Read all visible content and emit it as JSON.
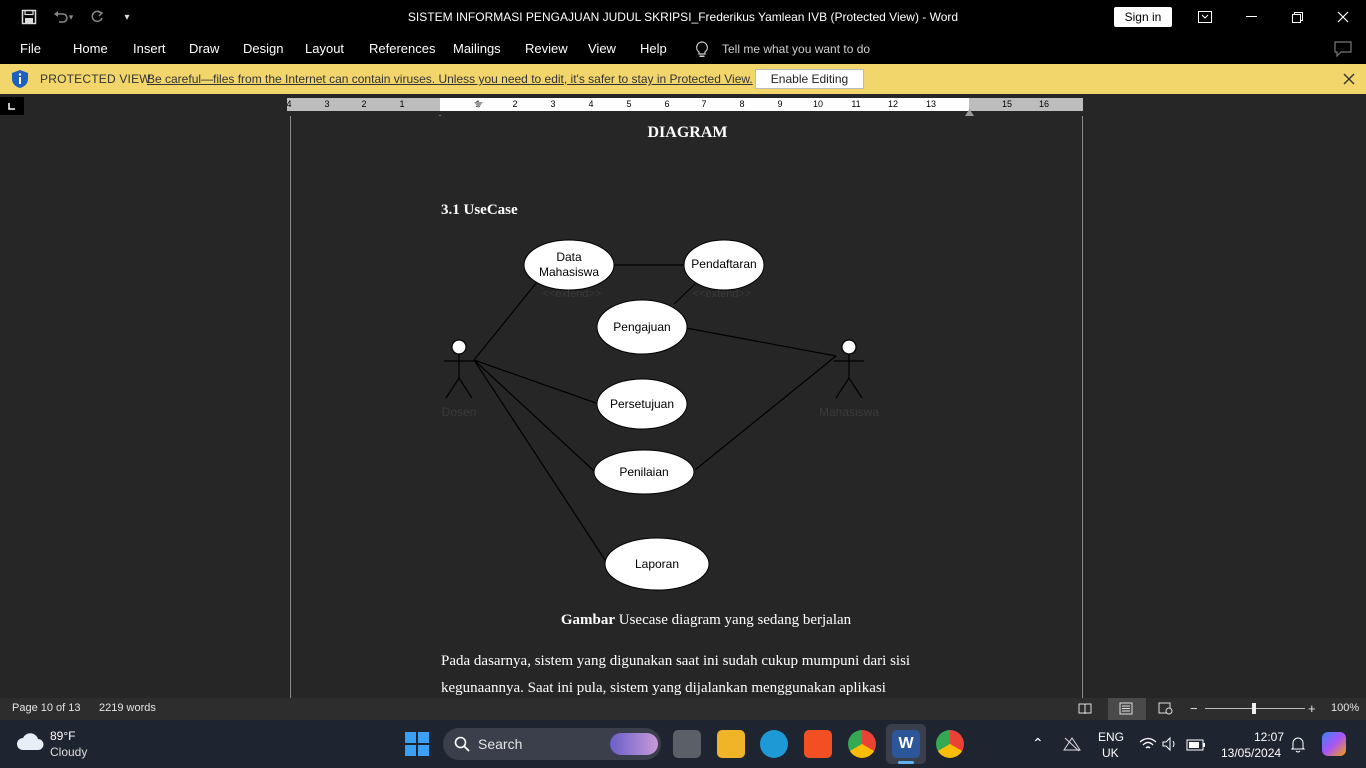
{
  "window": {
    "title": "SISTEM INFORMASI PENGAJUAN JUDUL SKRIPSI_Frederikus Yamlean IVB (Protected View)  -  Word",
    "sign_in": "Sign in"
  },
  "ribbon": {
    "tabs": [
      "File",
      "Home",
      "Insert",
      "Draw",
      "Design",
      "Layout",
      "References",
      "Mailings",
      "Review",
      "View",
      "Help"
    ],
    "tell_me": "Tell me what you want to do"
  },
  "protected_view": {
    "title": "PROTECTED VIEW",
    "message": "Be careful—files from the Internet can contain viruses. Unless you need to edit, it's safer to stay in Protected View.",
    "enable_button": "Enable Editing"
  },
  "ruler": {
    "labels": [
      "4",
      "3",
      "2",
      "1",
      "1",
      "2",
      "3",
      "4",
      "5",
      "6",
      "7",
      "8",
      "9",
      "10",
      "11",
      "12",
      "13",
      "15",
      "16"
    ]
  },
  "document": {
    "heading": "DIAGRAM",
    "section": "3.1 UseCase",
    "caption_bold": "Gambar",
    "caption_rest": " Usecase diagram yang sedang berjalan",
    "body_line1": "Pada dasarnya, sistem yang digunakan saat ini sudah cukup mumpuni dari sisi",
    "body_line2": "kegunaannya. Saat ini pula, sistem yang dijalankan menggunakan aplikasi"
  },
  "usecase": {
    "actors": {
      "left": "Dosen",
      "right": "Mahasiswa"
    },
    "cases": {
      "data_mhs_1": "Data",
      "data_mhs_2": "Mahasiswa",
      "pendaftaran": "Pendaftaran",
      "pengajuan": "Pengajuan",
      "persetujuan": "Persetujuan",
      "penilaian": "Penilaian",
      "laporan": "Laporan"
    },
    "extend_label_1": "<<extend>>",
    "extend_label_2": "<<extend>>"
  },
  "statusbar": {
    "page": "Page 10 of 13",
    "words": "2219 words",
    "zoom": "100%"
  },
  "taskbar": {
    "weather_temp": "89°F",
    "weather_desc": "Cloudy",
    "search": "Search",
    "lang_1": "ENG",
    "lang_2": "UK",
    "time": "12:07",
    "date": "13/05/2024"
  },
  "colors": {
    "protected_bar": "#f3d66b",
    "page_bg": "#262626",
    "word_blue": "#2b579a"
  }
}
